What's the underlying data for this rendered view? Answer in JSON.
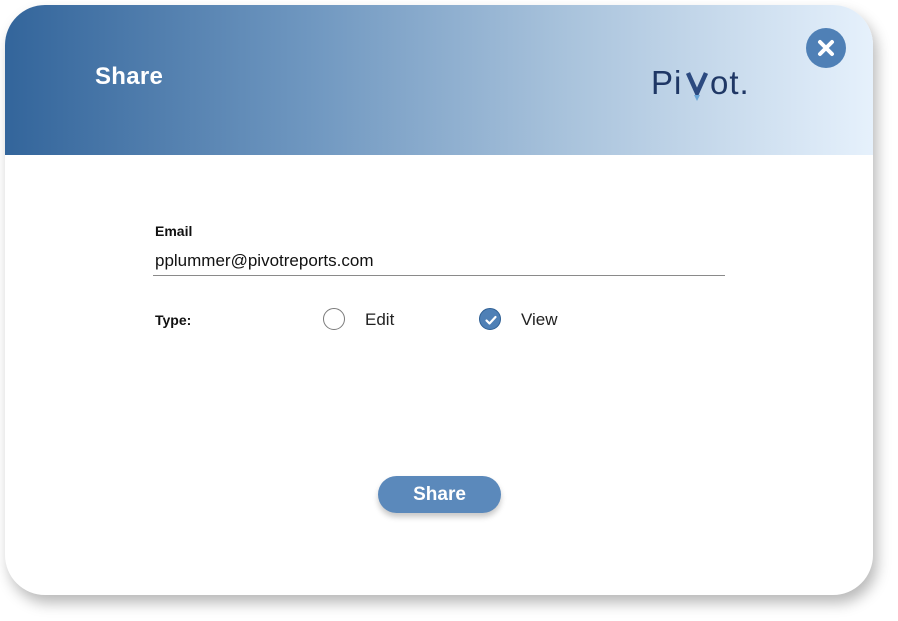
{
  "dialog": {
    "title": "Share",
    "logo_text": "Pivot.",
    "close_icon": "close-icon"
  },
  "form": {
    "email_label": "Email",
    "email_value": "pplummer@pivotreports.com",
    "type_label": "Type:",
    "options": [
      {
        "label": "Edit",
        "checked": false
      },
      {
        "label": "View",
        "checked": true
      }
    ]
  },
  "actions": {
    "share_label": "Share"
  },
  "colors": {
    "header_start": "#33659b",
    "header_end": "#e6f1fc",
    "accent": "#4f80b6",
    "button": "#5b89bb",
    "logo": "#1f3765"
  }
}
